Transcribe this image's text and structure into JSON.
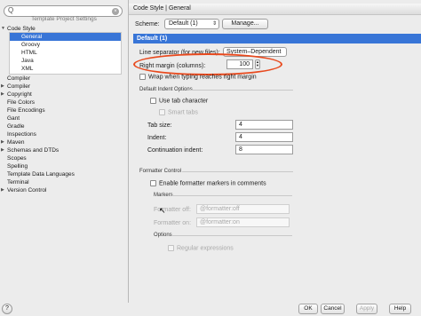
{
  "sidebar": {
    "search_glyph": "Q",
    "search_clear": "×",
    "section_label": "Template Project Settings",
    "tree": [
      {
        "label": "Code Style",
        "level": 0,
        "expanded": true
      },
      {
        "label": "General",
        "level": 1,
        "selected": true
      },
      {
        "label": "Groovy",
        "level": 1
      },
      {
        "label": "HTML",
        "level": 1
      },
      {
        "label": "Java",
        "level": 1
      },
      {
        "label": "XML",
        "level": 1
      },
      {
        "label": "Compiler",
        "level": 0
      },
      {
        "label": "Compiler",
        "level": 0,
        "collapsed": true
      },
      {
        "label": "Copyright",
        "level": 0,
        "collapsed": true
      },
      {
        "label": "File Colors",
        "level": 0
      },
      {
        "label": "File Encodings",
        "level": 0
      },
      {
        "label": "Gant",
        "level": 0
      },
      {
        "label": "Gradle",
        "level": 0
      },
      {
        "label": "Inspections",
        "level": 0
      },
      {
        "label": "Maven",
        "level": 0,
        "collapsed": true
      },
      {
        "label": "Schemas and DTDs",
        "level": 0,
        "collapsed": true
      },
      {
        "label": "Scopes",
        "level": 0
      },
      {
        "label": "Spelling",
        "level": 0
      },
      {
        "label": "Template Data Languages",
        "level": 0
      },
      {
        "label": "Terminal",
        "level": 0
      },
      {
        "label": "Version Control",
        "level": 0,
        "collapsed": true
      }
    ]
  },
  "header": {
    "breadcrumb": "Code Style | General"
  },
  "scheme": {
    "label": "Scheme:",
    "value": "Default (1)",
    "manage_label": "Manage..."
  },
  "default_bar": "Default (1)",
  "general": {
    "line_separator_label": "Line separator (for new files):",
    "line_separator_value": "System–Dependent",
    "right_margin_label": "Right margin (columns):",
    "right_margin_value": "100",
    "wrap_label": "Wrap when typing reaches right margin",
    "highlight_color": "#e8491d"
  },
  "indent": {
    "title": "Default Indent Options",
    "use_tab_label": "Use tab character",
    "smart_tabs_label": "Smart tabs",
    "tab_size_label": "Tab size:",
    "tab_size_value": "4",
    "indent_label": "Indent:",
    "indent_value": "4",
    "continuation_label": "Continuation indent:",
    "continuation_value": "8"
  },
  "formatter": {
    "title": "Formatter Control",
    "enable_label": "Enable formatter markers in comments",
    "markers_title": "Markers",
    "off_label": "Formatter off:",
    "off_value": "@formatter:off",
    "on_label": "Formatter on:",
    "on_value": "@formatter:on",
    "options_title": "Options",
    "regex_label": "Regular expressions"
  },
  "footer": {
    "help_icon": "?",
    "ok": "OK",
    "cancel": "Cancel",
    "apply": "Apply",
    "help": "Help"
  },
  "colors": {
    "selection": "#3875d7",
    "panel": "#ececec"
  }
}
